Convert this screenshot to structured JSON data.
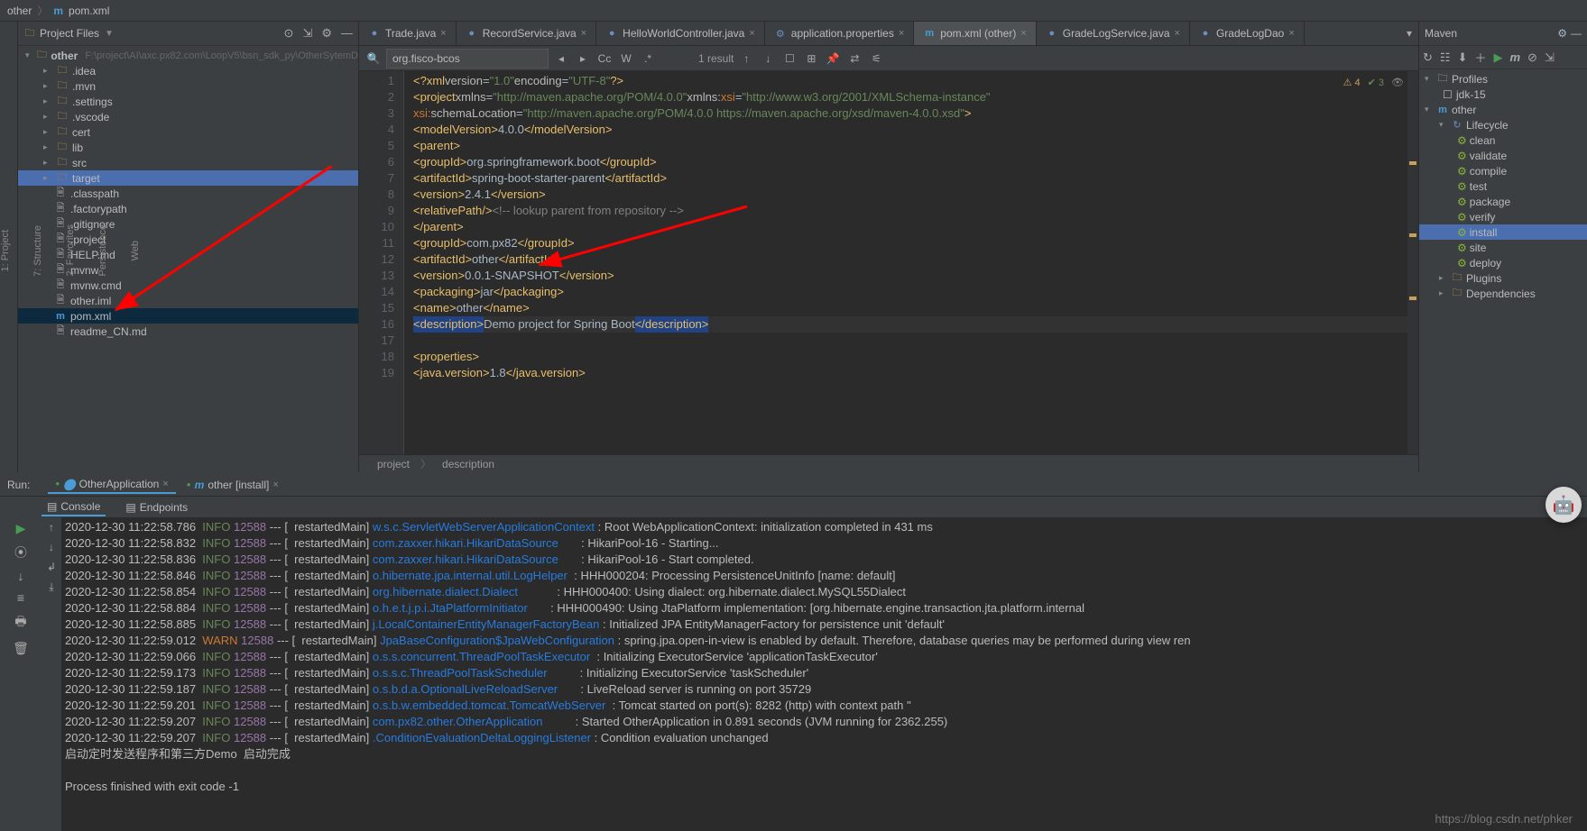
{
  "breadcrumb": {
    "root": "other",
    "file": "pom.xml"
  },
  "project": {
    "header_title": "Project Files",
    "root_name": "other",
    "root_path": "F:\\project\\AI\\axc.px82.com\\LoopV5\\bsn_sdk_py\\OtherSytemD",
    "folders_closed": [
      ".idea",
      ".mvn",
      ".settings",
      ".vscode",
      "cert",
      "lib",
      "src"
    ],
    "folder_highlight": "target",
    "files": [
      {
        "name": ".classpath"
      },
      {
        "name": ".factorypath"
      },
      {
        "name": ".gitignore"
      },
      {
        "name": ".project"
      },
      {
        "name": "HELP.md"
      },
      {
        "name": "mvnw"
      },
      {
        "name": "mvnw.cmd"
      },
      {
        "name": "other.iml"
      },
      {
        "name": "pom.xml",
        "selected": true
      },
      {
        "name": "readme_CN.md"
      }
    ]
  },
  "tabs": [
    {
      "label": "Trade.java"
    },
    {
      "label": "RecordService.java"
    },
    {
      "label": "HelloWorldController.java"
    },
    {
      "label": "application.properties"
    },
    {
      "label": "pom.xml (other)",
      "active": true
    },
    {
      "label": "GradeLogService.java"
    },
    {
      "label": "GradeLogDao"
    }
  ],
  "find": {
    "query": "org.fisco-bcos",
    "results": "1 result"
  },
  "inspections": {
    "warn": "4",
    "ok": "3",
    "eye": ""
  },
  "code_lines": [
    {
      "n": 1,
      "html": "<span class='tag-y'>&lt;?xml</span> <span class='attr'>version</span>=<span class='str'>\"1.0\"</span> <span class='attr'>encoding</span>=<span class='str'>\"UTF-8\"</span><span class='tag-y'>?&gt;</span>"
    },
    {
      "n": 2,
      "html": "<span class='tag-y'>&lt;project</span> <span class='attr'>xmlns</span>=<span class='str'>\"http://maven.apache.org/POM/4.0.0\"</span> <span class='attr'>xmlns:</span><span class='tag-o'>xsi</span>=<span class='str'>\"http://www.w3.org/2001/XMLSchema-instance\"</span>"
    },
    {
      "n": 3,
      "html": "         <span class='tag-o'>xsi:</span><span class='attr'>schemaLocation</span>=<span class='str'>\"http://maven.apache.org/POM/4.0.0 https://maven.apache.org/xsd/maven-4.0.0.xsd\"</span><span class='tag-y'>&gt;</span>"
    },
    {
      "n": 4,
      "html": "    <span class='tag-y'>&lt;modelVersion&gt;</span>4.0.0<span class='tag-y'>&lt;/modelVersion&gt;</span>"
    },
    {
      "n": 5,
      "html": "    <span class='tag-y'>&lt;parent&gt;</span>"
    },
    {
      "n": 6,
      "html": "        <span class='tag-y'>&lt;groupId&gt;</span>org.springframework.boot<span class='tag-y'>&lt;/groupId&gt;</span>"
    },
    {
      "n": 7,
      "html": "        <span class='tag-y'>&lt;artifactId&gt;</span>spring-boot-starter-parent<span class='tag-y'>&lt;/artifactId&gt;</span>"
    },
    {
      "n": 8,
      "html": "        <span class='tag-y'>&lt;version&gt;</span>2.4.1<span class='tag-y'>&lt;/version&gt;</span>"
    },
    {
      "n": 9,
      "html": "        <span class='tag-y'>&lt;relativePath/&gt;</span> <span class='comment'>&lt;!-- lookup parent from repository --&gt;</span>"
    },
    {
      "n": 10,
      "html": "    <span class='tag-y'>&lt;/parent&gt;</span>"
    },
    {
      "n": 11,
      "html": "    <span class='tag-y'>&lt;groupId&gt;</span>com.px82<span class='tag-y'>&lt;/groupId&gt;</span>"
    },
    {
      "n": 12,
      "html": "    <span class='tag-y'>&lt;artifactId&gt;</span>other<span class='tag-y'>&lt;/artifactId&gt;</span>"
    },
    {
      "n": 13,
      "html": "    <span class='tag-y'>&lt;version&gt;</span>0.0.1-SNAPSHOT<span class='tag-y'>&lt;/version&gt;</span>"
    },
    {
      "n": 14,
      "html": "    <span class='tag-y'>&lt;packaging&gt;</span>jar<span class='tag-y'>&lt;/packaging&gt;</span>"
    },
    {
      "n": 15,
      "html": "    <span class='tag-y'>&lt;name&gt;</span>other<span class='tag-y'>&lt;/name&gt;</span>"
    },
    {
      "n": 16,
      "hl": true,
      "html": "    <span class='sel-bg'>&lt;description&gt;</span>Demo project for Spring Boot<span class='sel-bg'>&lt;/description&gt;</span>"
    },
    {
      "n": 17,
      "html": ""
    },
    {
      "n": 18,
      "html": "    <span class='tag-y'>&lt;properties&gt;</span>"
    },
    {
      "n": 19,
      "html": "        <span class='tag-y'>&lt;java.version&gt;</span>1.8<span class='tag-y'>&lt;/java.version&gt;</span>"
    }
  ],
  "editor_status": [
    "project",
    "description"
  ],
  "maven": {
    "title": "Maven",
    "profiles": "Profiles",
    "jdk": "jdk-15",
    "module": "other",
    "lifecycle_label": "Lifecycle",
    "lifecycle": [
      "clean",
      "validate",
      "compile",
      "test",
      "package",
      "verify",
      "install",
      "site",
      "deploy"
    ],
    "selected": "install",
    "plugins": "Plugins",
    "dependencies": "Dependencies"
  },
  "run": {
    "label": "Run:",
    "tabs": [
      {
        "label": "OtherApplication",
        "active": true
      },
      {
        "label": "other [install]"
      }
    ],
    "subtabs": [
      {
        "label": "Console",
        "active": true
      },
      {
        "label": "Endpoints"
      }
    ],
    "logs": [
      {
        "ts": "2020-12-30 11:22:58.786",
        "lvl": "INFO",
        "pid": "12588",
        "thr": "restartedMain",
        "cls": "w.s.c.ServletWebServerApplicationContext",
        "msg": "Root WebApplicationContext: initialization completed in 431 ms"
      },
      {
        "ts": "2020-12-30 11:22:58.832",
        "lvl": "INFO",
        "pid": "12588",
        "thr": "restartedMain",
        "cls": "com.zaxxer.hikari.HikariDataSource",
        "msg": "HikariPool-16 - Starting..."
      },
      {
        "ts": "2020-12-30 11:22:58.836",
        "lvl": "INFO",
        "pid": "12588",
        "thr": "restartedMain",
        "cls": "com.zaxxer.hikari.HikariDataSource",
        "msg": "HikariPool-16 - Start completed."
      },
      {
        "ts": "2020-12-30 11:22:58.846",
        "lvl": "INFO",
        "pid": "12588",
        "thr": "restartedMain",
        "cls": "o.hibernate.jpa.internal.util.LogHelper",
        "msg": "HHH000204: Processing PersistenceUnitInfo [name: default]"
      },
      {
        "ts": "2020-12-30 11:22:58.854",
        "lvl": "INFO",
        "pid": "12588",
        "thr": "restartedMain",
        "cls": "org.hibernate.dialect.Dialect",
        "msg": "HHH000400: Using dialect: org.hibernate.dialect.MySQL55Dialect"
      },
      {
        "ts": "2020-12-30 11:22:58.884",
        "lvl": "INFO",
        "pid": "12588",
        "thr": "restartedMain",
        "cls": "o.h.e.t.j.p.i.JtaPlatformInitiator",
        "msg": "HHH000490: Using JtaPlatform implementation: [org.hibernate.engine.transaction.jta.platform.internal"
      },
      {
        "ts": "2020-12-30 11:22:58.885",
        "lvl": "INFO",
        "pid": "12588",
        "thr": "restartedMain",
        "cls": "j.LocalContainerEntityManagerFactoryBean",
        "msg": "Initialized JPA EntityManagerFactory for persistence unit 'default'"
      },
      {
        "ts": "2020-12-30 11:22:59.012",
        "lvl": "WARN",
        "pid": "12588",
        "thr": "restartedMain",
        "cls": "JpaBaseConfiguration$JpaWebConfiguration",
        "msg": "spring.jpa.open-in-view is enabled by default. Therefore, database queries may be performed during view ren"
      },
      {
        "ts": "2020-12-30 11:22:59.066",
        "lvl": "INFO",
        "pid": "12588",
        "thr": "restartedMain",
        "cls": "o.s.s.concurrent.ThreadPoolTaskExecutor",
        "msg": "Initializing ExecutorService 'applicationTaskExecutor'"
      },
      {
        "ts": "2020-12-30 11:22:59.173",
        "lvl": "INFO",
        "pid": "12588",
        "thr": "restartedMain",
        "cls": "o.s.s.c.ThreadPoolTaskScheduler",
        "msg": "Initializing ExecutorService 'taskScheduler'"
      },
      {
        "ts": "2020-12-30 11:22:59.187",
        "lvl": "INFO",
        "pid": "12588",
        "thr": "restartedMain",
        "cls": "o.s.b.d.a.OptionalLiveReloadServer",
        "msg": "LiveReload server is running on port 35729"
      },
      {
        "ts": "2020-12-30 11:22:59.201",
        "lvl": "INFO",
        "pid": "12588",
        "thr": "restartedMain",
        "cls": "o.s.b.w.embedded.tomcat.TomcatWebServer",
        "msg": "Tomcat started on port(s): 8282 (http) with context path ''"
      },
      {
        "ts": "2020-12-30 11:22:59.207",
        "lvl": "INFO",
        "pid": "12588",
        "thr": "restartedMain",
        "cls": "com.px82.other.OtherApplication",
        "msg": "Started OtherApplication in 0.891 seconds (JVM running for 2362.255)"
      },
      {
        "ts": "2020-12-30 11:22:59.207",
        "lvl": "INFO",
        "pid": "12588",
        "thr": "restartedMain",
        "cls": ".ConditionEvaluationDeltaLoggingListener",
        "msg": "Condition evaluation unchanged"
      }
    ],
    "tail1": "启动定时发送程序和第三方Demo  启动完成",
    "tail2": "Process finished with exit code -1"
  },
  "watermark": "https://blog.csdn.net/phker"
}
